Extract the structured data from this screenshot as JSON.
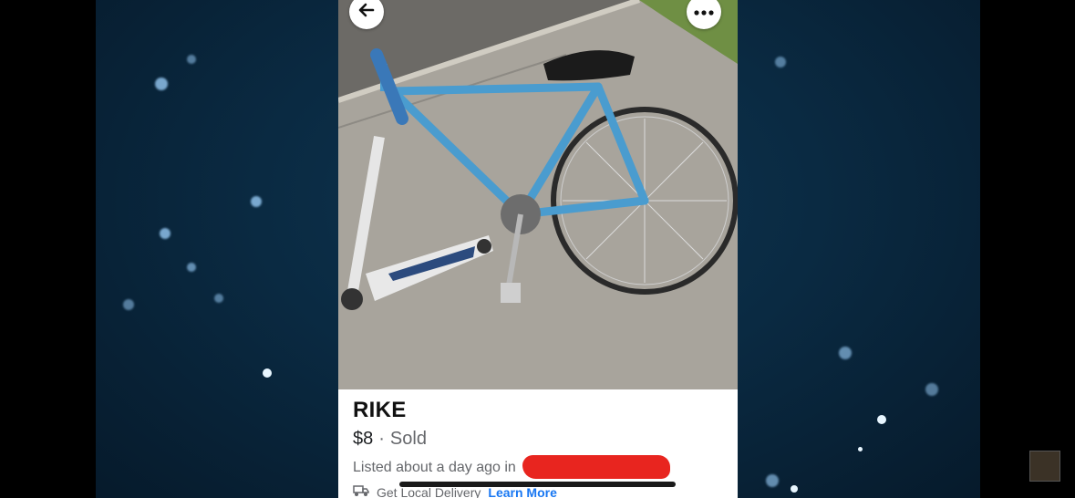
{
  "listing": {
    "title": "RIKE",
    "price": "$8",
    "separator": "·",
    "status": "Sold",
    "listed_text": "Listed about a day ago in",
    "delivery_text": "Get Local Delivery",
    "learn_more": "Learn More"
  },
  "icons": {
    "back": "arrow-left-icon",
    "more": "more-horizontal-icon",
    "delivery": "delivery-truck-icon"
  },
  "colors": {
    "background": "#0a2a42",
    "learn_more": "#1877f2",
    "redaction": "#e8251f"
  }
}
